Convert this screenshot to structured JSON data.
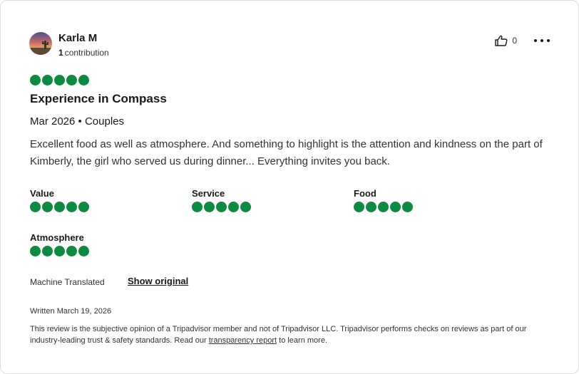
{
  "review": {
    "author": {
      "name": "Karla M",
      "contributions_count": "1",
      "contributions_label": "contribution"
    },
    "helpful_count": "0",
    "overall_rating": 5,
    "title": "Experience in Compass",
    "meta": "Mar 2026 • Couples",
    "body": "Excellent food as well as atmosphere. And something to highlight is the attention and kindness on the part of Kimberly, the girl who served us during dinner... Everything invites you back.",
    "sub_ratings": [
      {
        "label": "Value",
        "rating": 5
      },
      {
        "label": "Service",
        "rating": 5
      },
      {
        "label": "Food",
        "rating": 5
      },
      {
        "label": "Atmosphere",
        "rating": 5
      }
    ],
    "translation_label": "Machine Translated",
    "show_original_label": "Show original",
    "written_date": "Written March 19, 2026",
    "disclaimer_before": "This review is the subjective opinion of a Tripadvisor member and not of Tripadvisor LLC. Tripadvisor performs checks on reviews as part of our industry-leading trust & safety standards. Read our ",
    "disclaimer_link": "transparency report",
    "disclaimer_after": " to learn more."
  },
  "colors": {
    "bubble": "#0c8a3f",
    "text_dark": "#1a1a1a",
    "border": "#dcdcdc"
  },
  "icons": {
    "helpful": "thumbs-up-icon",
    "more": "ellipsis-icon"
  }
}
